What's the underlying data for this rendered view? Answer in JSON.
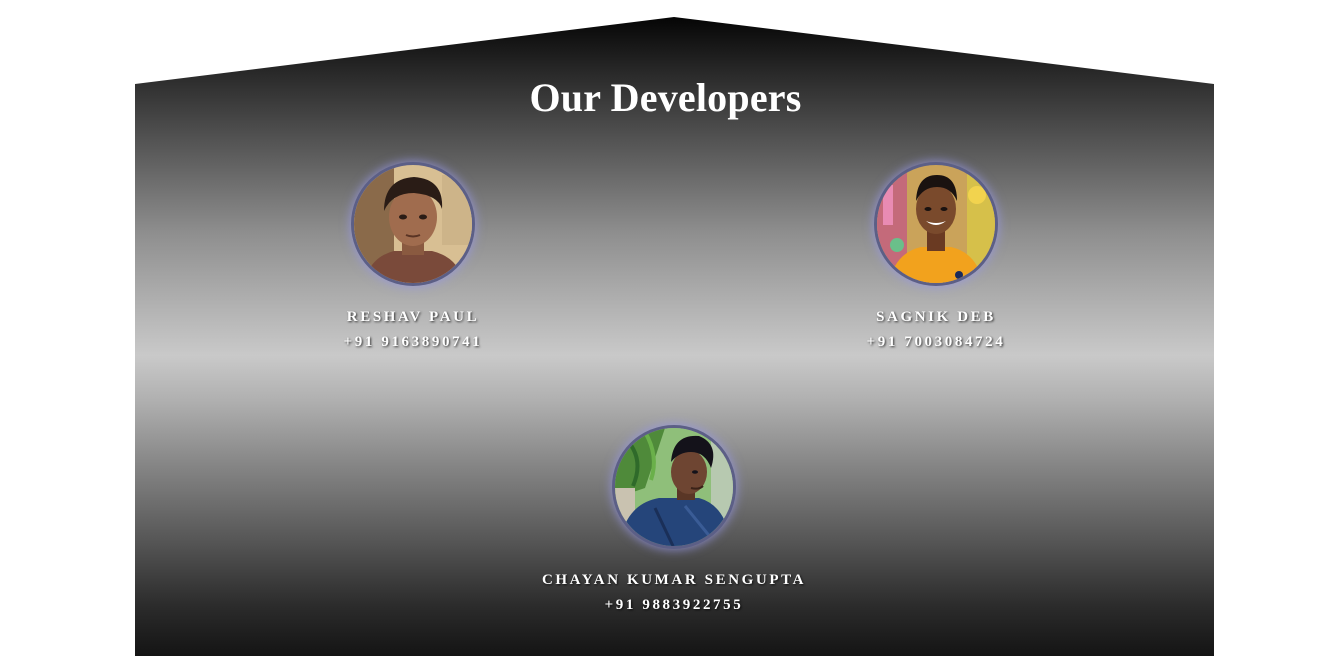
{
  "section": {
    "title": "Our Developers"
  },
  "developers": [
    {
      "name": "RESHAV PAUL",
      "phone": "+91 9163890741",
      "photo_icon": "person-photo"
    },
    {
      "name": "SAGNIK DEB",
      "phone": "+91 7003084724",
      "photo_icon": "person-photo"
    },
    {
      "name": "CHAYAN KUMAR SENGUPTA",
      "phone": "+91 9883922755",
      "photo_icon": "person-photo"
    }
  ],
  "colors": {
    "title_text": "#ffffff",
    "panel_dark": "#050505",
    "panel_light": "#c9c9c9",
    "avatar_glow": "#9696e6"
  }
}
